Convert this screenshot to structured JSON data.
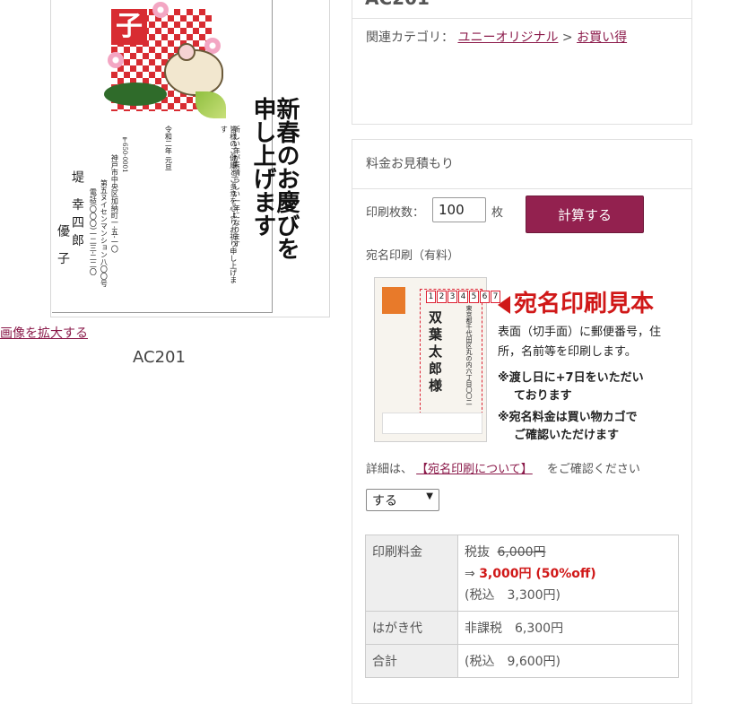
{
  "product": {
    "code": "AC201",
    "enlarge_link": "画像を拡大する",
    "image": {
      "zodiac_char": "子",
      "greeting": "新春のお慶びを申し上げます",
      "message_lines": [
        "新しい年が素晴らしい一年になります",
        "皆様のご健康とご多幸を心よりお祈り申し上げます",
        "令和二年 元旦"
      ],
      "address_lines": [
        "〒650-0001",
        "神戸市中央区加納町一-五-一〇",
        "第五ヌイセンマンション八〇〇号",
        "電話(〇〇〇)一二三-二二〇"
      ],
      "names": [
        "堤 幸四郎",
        "優 子"
      ]
    }
  },
  "top_panel": {
    "title": "AC201",
    "category_label": "関連カテゴリ：",
    "category_1": "ユニーオリジナル",
    "separator": ">",
    "category_2": "お買い得"
  },
  "estimate": {
    "title": "料金お見積もり",
    "qty_label": "印刷枚数：",
    "qty_value": "100",
    "qty_unit": "枚",
    "calc_button": "計算する",
    "address_print_label": "宛名印刷（有料）",
    "sample": {
      "title": "宛名印刷見本",
      "postal_digits": [
        "1",
        "2",
        "3",
        "4",
        "5",
        "6",
        "7"
      ],
      "sample_name": "双葉太郎様",
      "sample_address": "東京都千代田区丸の内六丁目〇〇二",
      "desc": "表面（切手面）に郵便番号，住所，名前等を印刷します。",
      "note1_line1": "※渡し日に+7日をいただい",
      "note1_line2": "ております",
      "note2_line1": "※宛名料金は買い物カゴで",
      "note2_line2": "ご確認いただけます"
    },
    "detail_prefix": "詳細は、",
    "detail_link": "【宛名印刷について】",
    "detail_suffix": "をご確認ください",
    "select_value": "する",
    "table": {
      "row1_label": "印刷料金",
      "row1_tax_prefix": "税抜",
      "row1_original": "6,000円",
      "row1_arrow": "⇒",
      "row1_discount": "3,000円 (50%off)",
      "row1_tax_incl": "(税込　3,300円)",
      "row2_label": "はがき代",
      "row2_value": "非課税　6,300円",
      "row3_label": "合計",
      "row3_value": "(税込　9,600円)"
    }
  }
}
